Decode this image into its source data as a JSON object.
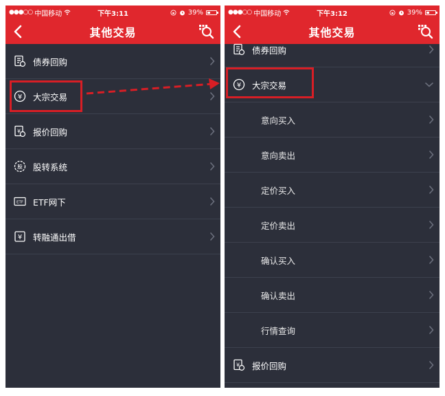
{
  "left_phone": {
    "status": {
      "carrier": "中国移动",
      "time": "下午3:11",
      "battery": "39%",
      "battery_level": 0.39
    },
    "nav": {
      "title": "其他交易"
    },
    "items": [
      {
        "label": "债券回购",
        "icon": "bond-repo-icon"
      },
      {
        "label": "大宗交易",
        "icon": "yen-circle-icon"
      },
      {
        "label": "报价回购",
        "icon": "quote-repo-icon"
      },
      {
        "label": "股转系统",
        "icon": "share-transfer-icon"
      },
      {
        "label": "ETF网下",
        "icon": "etf-icon"
      },
      {
        "label": "转融通出借",
        "icon": "yen-box-icon"
      }
    ]
  },
  "right_phone": {
    "status": {
      "carrier": "中国移动",
      "time": "下午3:12",
      "battery": "39%",
      "battery_level": 0.39
    },
    "nav": {
      "title": "其他交易"
    },
    "items": [
      {
        "label": "债券回购"
      },
      {
        "label": "大宗交易"
      },
      {
        "label": "意向买入"
      },
      {
        "label": "意向卖出"
      },
      {
        "label": "定价买入"
      },
      {
        "label": "定价卖出"
      },
      {
        "label": "确认买入"
      },
      {
        "label": "确认卖出"
      },
      {
        "label": "行情查询"
      },
      {
        "label": "报价回购"
      }
    ]
  },
  "colors": {
    "header_red": "#e0272d",
    "list_bg": "#2c2f3a",
    "highlight": "#d81e25"
  }
}
